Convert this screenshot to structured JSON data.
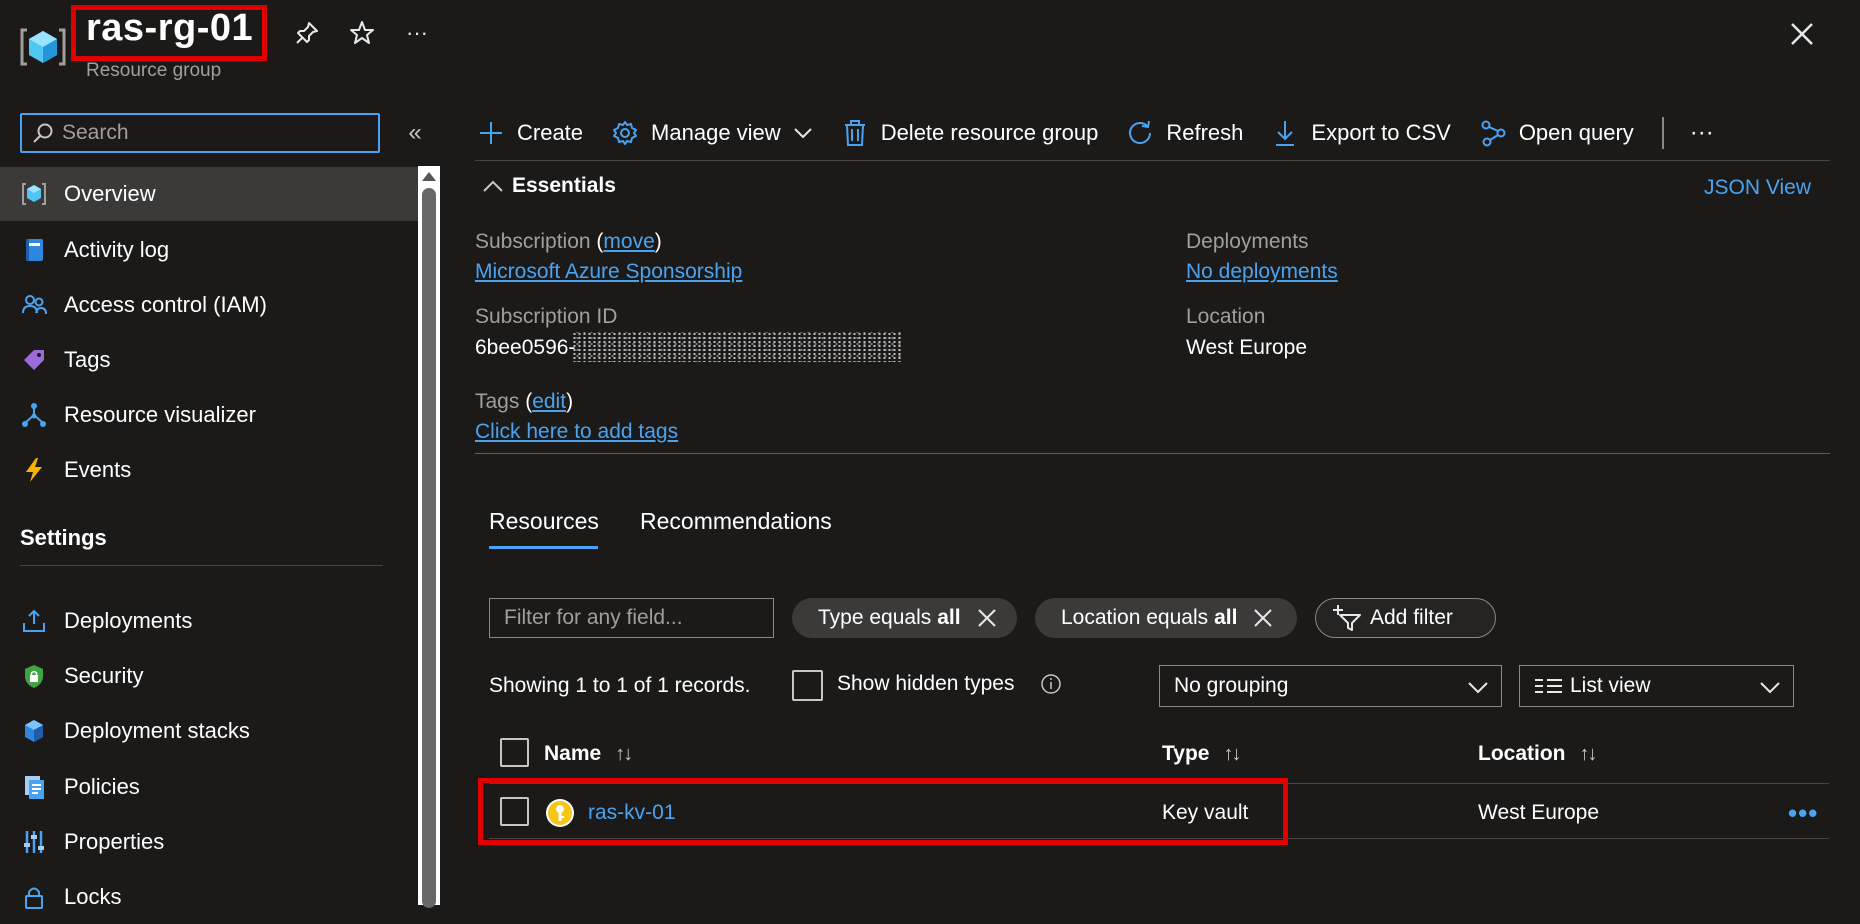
{
  "header": {
    "title": "ras-rg-01",
    "subtitle": "Resource group",
    "more_label": "···"
  },
  "sidebar": {
    "search_placeholder": "Search",
    "collapse_label": "«",
    "items": [
      {
        "label": "Overview",
        "icon": "resource-group-icon",
        "active": true
      },
      {
        "label": "Activity log",
        "icon": "activity-log-icon"
      },
      {
        "label": "Access control (IAM)",
        "icon": "people-icon"
      },
      {
        "label": "Tags",
        "icon": "tag-icon"
      },
      {
        "label": "Resource visualizer",
        "icon": "hierarchy-icon"
      },
      {
        "label": "Events",
        "icon": "lightning-icon"
      }
    ],
    "settings_heading": "Settings",
    "settings_items": [
      {
        "label": "Deployments",
        "icon": "upload-icon"
      },
      {
        "label": "Security",
        "icon": "shield-lock-icon"
      },
      {
        "label": "Deployment stacks",
        "icon": "cube-icon"
      },
      {
        "label": "Policies",
        "icon": "policy-document-icon"
      },
      {
        "label": "Properties",
        "icon": "sliders-icon"
      },
      {
        "label": "Locks",
        "icon": "lock-icon"
      }
    ]
  },
  "toolbar": {
    "create": "Create",
    "manage_view": "Manage view",
    "delete": "Delete resource group",
    "refresh": "Refresh",
    "export": "Export to CSV",
    "open_query": "Open query",
    "more": "···"
  },
  "essentials": {
    "heading": "Essentials",
    "json_view": "JSON View",
    "subscription_label": "Subscription",
    "move_link": "move",
    "subscription_value": "Microsoft Azure Sponsorship",
    "subscription_id_label": "Subscription ID",
    "subscription_id_value": "6bee0596-",
    "tags_label": "Tags",
    "edit_link": "edit",
    "tags_value": "Click here to add tags",
    "deployments_label": "Deployments",
    "deployments_value": "No deployments",
    "location_label": "Location",
    "location_value": "West Europe"
  },
  "tabs": {
    "resources": "Resources",
    "recommendations": "Recommendations"
  },
  "filters": {
    "placeholder": "Filter for any field...",
    "type_prefix": "Type equals",
    "type_value": "all",
    "location_prefix": "Location equals",
    "location_value": "all",
    "add_filter": "Add filter"
  },
  "records": {
    "summary": "Showing 1 to 1 of 1 records.",
    "show_hidden": "Show hidden types",
    "grouping": "No grouping",
    "view": "List view"
  },
  "table": {
    "columns": [
      "Name",
      "Type",
      "Location"
    ],
    "sort_glyph": "↑↓",
    "rows": [
      {
        "name": "ras-kv-01",
        "type": "Key vault",
        "location": "West Europe",
        "more": "•••"
      }
    ]
  },
  "colors": {
    "accent": "#4aa3f0",
    "highlight": "#e00000",
    "background": "#1b1a19"
  }
}
